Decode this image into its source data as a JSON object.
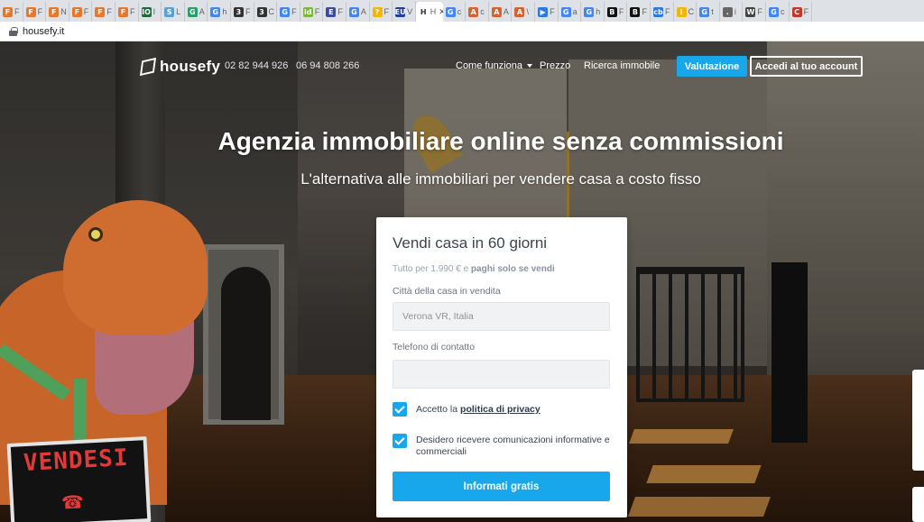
{
  "browser": {
    "tabs": [
      {
        "icon": "F",
        "color": "#e8772e",
        "label": "F"
      },
      {
        "icon": "F",
        "color": "#e8772e",
        "label": "F"
      },
      {
        "icon": "F",
        "color": "#e8772e",
        "label": "N"
      },
      {
        "icon": "F",
        "color": "#e8772e",
        "label": "F"
      },
      {
        "icon": "F",
        "color": "#e8772e",
        "label": "F"
      },
      {
        "icon": "F",
        "color": "#e8772e",
        "label": "F"
      },
      {
        "icon": "IO",
        "color": "#1d6b3a",
        "label": "I"
      },
      {
        "icon": "S",
        "color": "#5aa0d6",
        "label": "L"
      },
      {
        "icon": "G",
        "color": "#2a9d6a",
        "label": "A"
      },
      {
        "icon": "G",
        "color": "#4285f4",
        "label": "h"
      },
      {
        "icon": "3",
        "color": "#333333",
        "label": "F"
      },
      {
        "icon": "3",
        "color": "#333333",
        "label": "C"
      },
      {
        "icon": "G",
        "color": "#4285f4",
        "label": "F"
      },
      {
        "icon": "id",
        "color": "#7ab83a",
        "label": "F"
      },
      {
        "icon": "E",
        "color": "#3b4aa8",
        "label": "F"
      },
      {
        "icon": "G",
        "color": "#4285f4",
        "label": "A"
      },
      {
        "icon": "?",
        "color": "#f2b705",
        "label": "F"
      },
      {
        "icon": "EU",
        "color": "#1f3da3",
        "label": "V"
      },
      {
        "icon": "H",
        "color": "#ffffff",
        "label": "H",
        "active": true
      },
      {
        "icon": "G",
        "color": "#4285f4",
        "label": "c"
      },
      {
        "icon": "A",
        "color": "#d8622f",
        "label": "c"
      },
      {
        "icon": "A",
        "color": "#d8622f",
        "label": "A"
      },
      {
        "icon": "A",
        "color": "#d8622f",
        "label": "\\"
      },
      {
        "icon": "▶",
        "color": "#2a7ae2",
        "label": "F"
      },
      {
        "icon": "G",
        "color": "#4285f4",
        "label": "a"
      },
      {
        "icon": "G",
        "color": "#4285f4",
        "label": "h"
      },
      {
        "icon": "B",
        "color": "#111111",
        "label": "F"
      },
      {
        "icon": "B",
        "color": "#111111",
        "label": "F"
      },
      {
        "icon": "cb",
        "color": "#2a7ae2",
        "label": "F"
      },
      {
        "icon": "i",
        "color": "#f2b705",
        "label": "C"
      },
      {
        "icon": "G",
        "color": "#4285f4",
        "label": "t"
      },
      {
        "icon": ".",
        "color": "#666666",
        "label": "i"
      },
      {
        "icon": "W",
        "color": "#444444",
        "label": "F"
      },
      {
        "icon": "G",
        "color": "#4285f4",
        "label": "c"
      },
      {
        "icon": "C",
        "color": "#c0392b",
        "label": "F"
      }
    ],
    "url": "housefy.it"
  },
  "header": {
    "logo_text": "housefy",
    "phone1": "02 82 944 926",
    "phone2": "06 94 808 266",
    "nav": {
      "come_funziona": "Come funziona",
      "prezzo": "Prezzo",
      "ricerca": "Ricerca immobile"
    },
    "valutazione_label": "Valutazione",
    "accedi_label": "Accedi al tuo account"
  },
  "hero": {
    "title": "Agenzia immobiliare online senza commissioni",
    "subtitle": "L'alternativa alle immobiliari per vendere casa a costo fisso",
    "sign_text": "VENDESI"
  },
  "form": {
    "title": "Vendi casa in 60 giorni",
    "note_prefix": "Tutto per 1.990 € e ",
    "note_bold": "paghi solo se vendi",
    "city_label": "Città della casa in vendita",
    "city_placeholder": "Verona VR, Italia",
    "phone_label": "Telefono di contatto",
    "phone_placeholder": "",
    "privacy_prefix": "Accetto la ",
    "privacy_link": "politica di privacy",
    "newsletter_label": "Desidero ricevere comunicazioni informative e commerciali",
    "cta_label": "Informati gratis"
  },
  "colors": {
    "accent": "#19a7ec"
  }
}
